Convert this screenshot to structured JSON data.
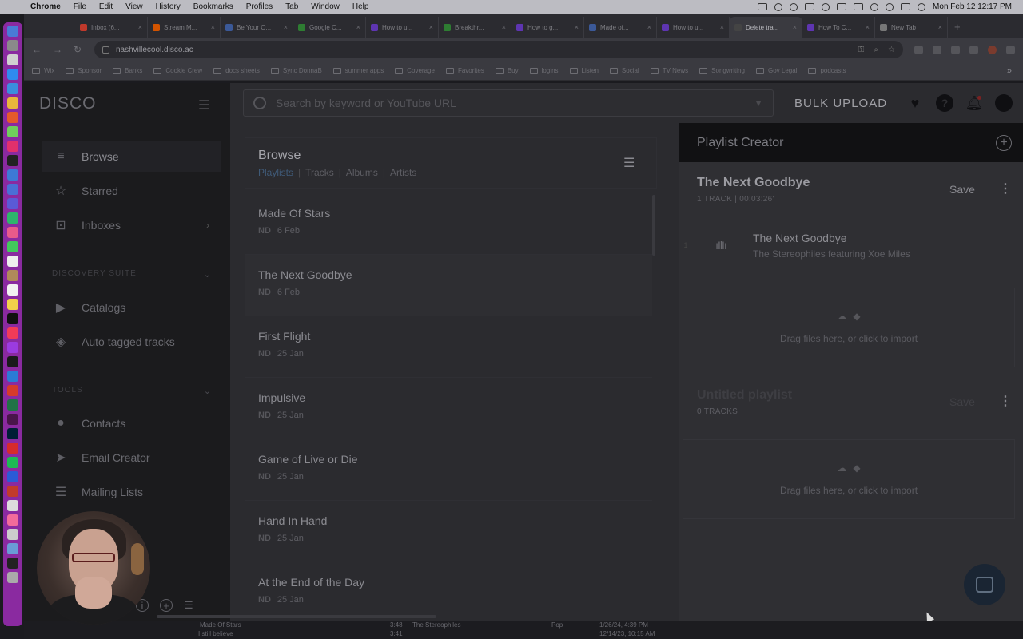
{
  "menubar": {
    "app": "Chrome",
    "items": [
      "File",
      "Edit",
      "View",
      "History",
      "Bookmarks",
      "Profiles",
      "Tab",
      "Window",
      "Help"
    ],
    "clock": "Mon Feb 12  12:17 PM"
  },
  "tabs": [
    {
      "title": "Inbox (6...",
      "color": "#c0392b"
    },
    {
      "title": "Stream M...",
      "color": "#d35400"
    },
    {
      "title": "Be Your O...",
      "color": "#3b5998"
    },
    {
      "title": "Google C...",
      "color": "#2e7d32"
    },
    {
      "title": "How to u...",
      "color": "#5e35b1"
    },
    {
      "title": "Breakthr...",
      "color": "#2e7d32"
    },
    {
      "title": "How to g...",
      "color": "#5e35b1"
    },
    {
      "title": "Made of...",
      "color": "#3b5998"
    },
    {
      "title": "How to u...",
      "color": "#5e35b1"
    },
    {
      "title": "Delete tra...",
      "color": "#444444",
      "active": true
    },
    {
      "title": "How To C...",
      "color": "#5e35b1"
    },
    {
      "title": "New Tab",
      "color": "#777777"
    }
  ],
  "address": {
    "url": "nashvillecool.disco.ac"
  },
  "bookmarks": [
    "Wix",
    "Sponsor",
    "Banks",
    "Cookie Crew",
    "docs sheets",
    "Sync DonnaB",
    "summer apps",
    "Coverage",
    "Favorites",
    "Buy",
    "logins",
    "Listen",
    "Social",
    "TV News",
    "Songwriting",
    "Gov Legal",
    "podcasts"
  ],
  "app": {
    "logo": "DISCO",
    "nav": [
      {
        "label": "Browse",
        "icon": "browse-icon",
        "active": true
      },
      {
        "label": "Starred",
        "icon": "star-icon"
      },
      {
        "label": "Inboxes",
        "icon": "inbox-icon",
        "chevron": "›"
      }
    ],
    "discovery_suite": {
      "label": "DISCOVERY SUITE",
      "items": [
        {
          "label": "Catalogs",
          "icon": "catalog-icon"
        },
        {
          "label": "Auto tagged tracks",
          "icon": "tag-icon"
        }
      ]
    },
    "tools": {
      "label": "TOOLS",
      "items": [
        {
          "label": "Contacts",
          "icon": "contacts-icon"
        },
        {
          "label": "Email Creator",
          "icon": "send-icon"
        },
        {
          "label": "Mailing Lists",
          "icon": "list-icon"
        }
      ]
    },
    "search": {
      "placeholder": "Search by keyword or YouTube URL"
    },
    "bulk_upload": "BULK UPLOAD"
  },
  "browse": {
    "title": "Browse",
    "filters": [
      "Playlists",
      "Tracks",
      "Albums",
      "Artists"
    ],
    "rows": [
      {
        "name": "Made Of Stars",
        "tag": "ND",
        "date": "6 Feb"
      },
      {
        "name": "The Next Goodbye",
        "tag": "ND",
        "date": "6 Feb"
      },
      {
        "name": "First Flight",
        "tag": "ND",
        "date": "25 Jan"
      },
      {
        "name": "Impulsive",
        "tag": "ND",
        "date": "25 Jan"
      },
      {
        "name": "Game of Live or Die",
        "tag": "ND",
        "date": "25 Jan"
      },
      {
        "name": "Hand In Hand",
        "tag": "ND",
        "date": "25 Jan"
      },
      {
        "name": "At the End of the Day",
        "tag": "ND",
        "date": "25 Jan"
      }
    ]
  },
  "playlist_creator": {
    "title": "Playlist Creator",
    "playlists": [
      {
        "name": "The Next Goodbye",
        "meta": "1 TRACK | 00:03:26'",
        "save": "Save",
        "track": {
          "number": "1",
          "title": "The Next Goodbye",
          "artist": "The Stereophiles featuring Xoe Miles"
        },
        "drop_text": "Drag files here, or click to import"
      },
      {
        "name": "Untitled playlist",
        "meta": "0 TRACKS",
        "save": "Save",
        "drop_text": "Drag files here, or click to import"
      }
    ]
  },
  "bottom": {
    "rows": [
      {
        "title": "Made Of Stars",
        "time": "3:48",
        "artist": "The Stereophiles",
        "genre": "Pop",
        "date": "1/26/24, 4:39 PM"
      },
      {
        "title": "I still believe",
        "time": "3:41",
        "date": "12/14/23, 10:15 AM"
      }
    ]
  }
}
